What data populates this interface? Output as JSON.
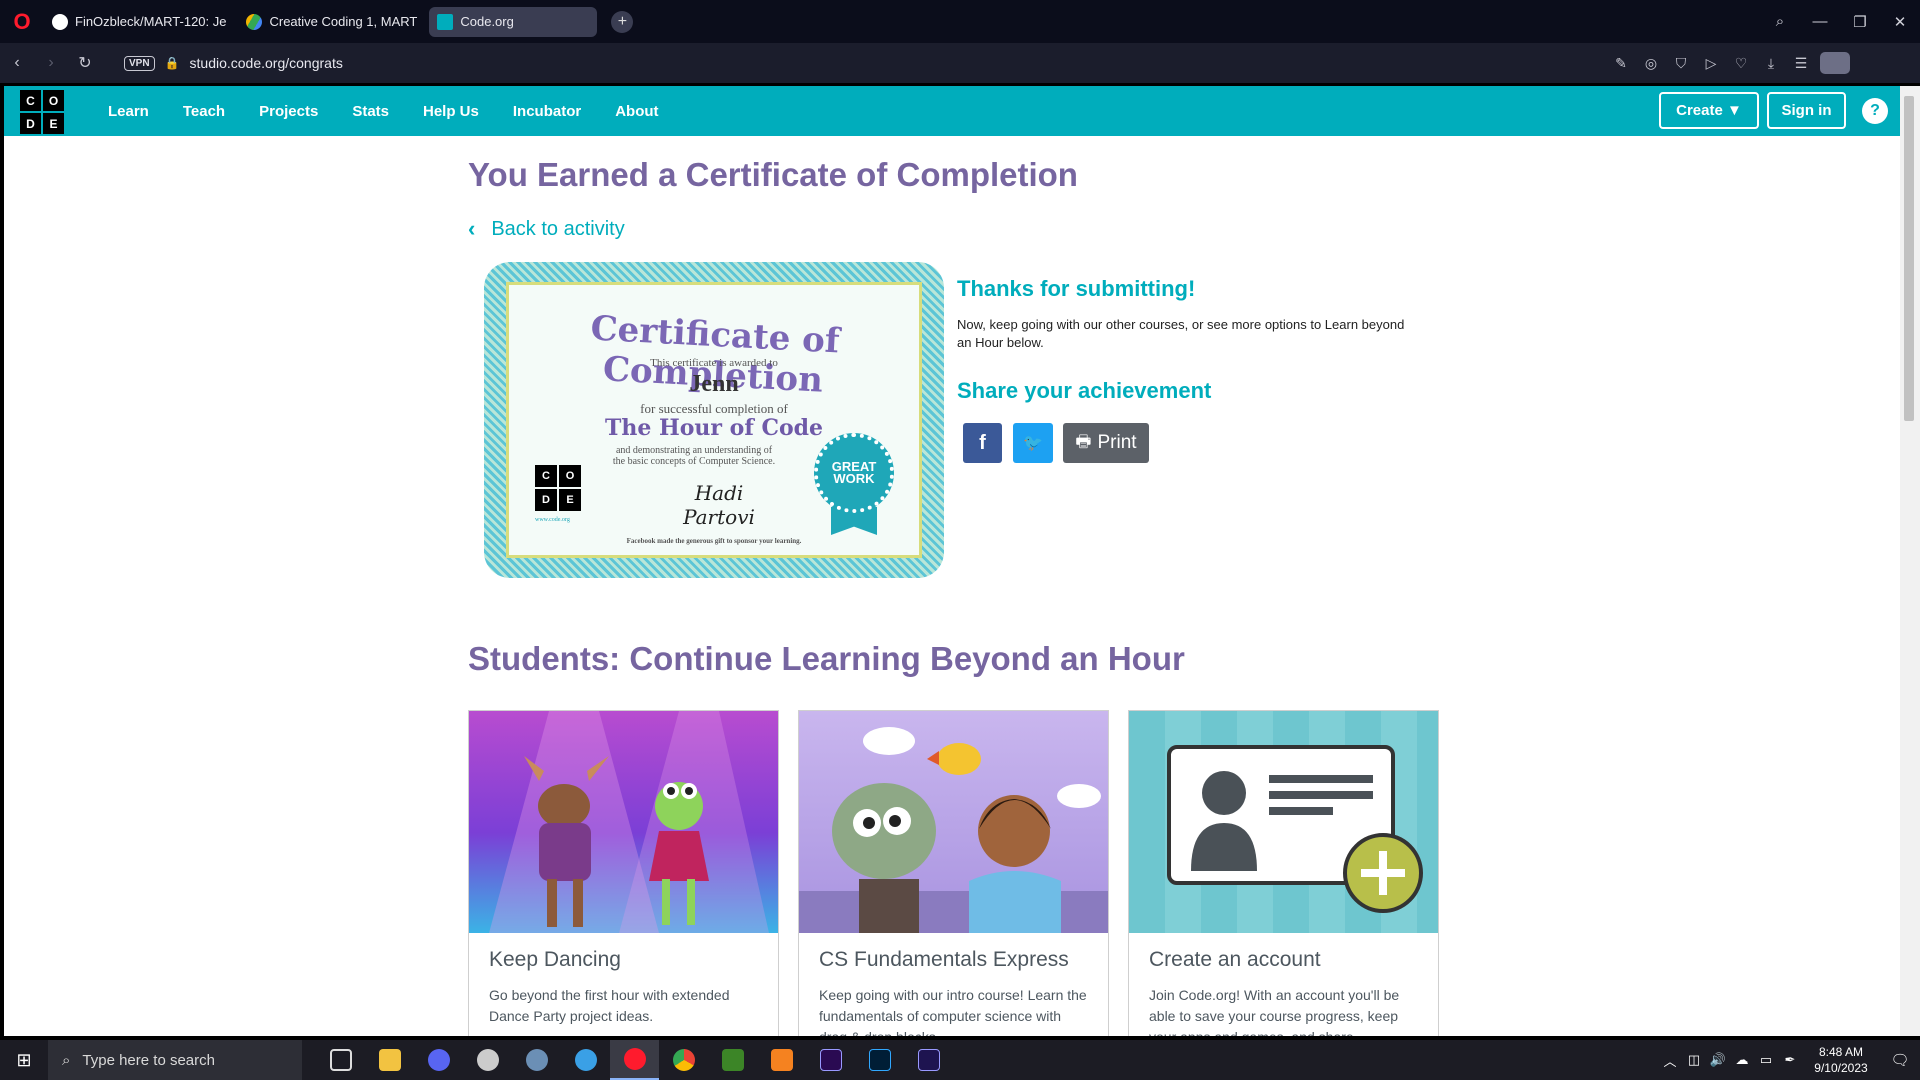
{
  "browser": {
    "tabs": [
      {
        "label": "FinOzbleck/MART-120: Je",
        "icon_color": "#ffffff"
      },
      {
        "label": "Creative Coding 1, MART",
        "icon_color": "#f2b400"
      },
      {
        "label": "Code.org",
        "icon_color": "#00adbc"
      }
    ],
    "new_tab": "+",
    "url": "studio.code.org/congrats",
    "vpn_label": "VPN"
  },
  "site_header": {
    "logo_letters": [
      "C",
      "O",
      "D",
      "E"
    ],
    "nav": [
      "Learn",
      "Teach",
      "Projects",
      "Stats",
      "Help Us",
      "Incubator",
      "About"
    ],
    "create_label": "Create ▼",
    "signin_label": "Sign in",
    "help_label": "?"
  },
  "main": {
    "title": "You Earned a Certificate of Completion",
    "back_label": "Back to activity",
    "certificate": {
      "heading": "Certificate of Completion",
      "awarded_text": "This certificate is awarded to",
      "name": "Jenn",
      "completion_text": "for successful completion of",
      "course": "The Hour of Code",
      "concepts_text": "and demonstrating an understanding of the basic concepts of Computer Science.",
      "signature": "Hadi Partovi",
      "badge_line1": "GREAT",
      "badge_line2": "WORK",
      "site": "www.code.org",
      "footer": "Facebook made the generous gift to sponsor your learning."
    },
    "thanks_heading": "Thanks for submitting!",
    "thanks_body": "Now, keep going with our other courses, or see more options to Learn beyond an Hour below.",
    "share_heading": "Share your achievement",
    "share_buttons": {
      "facebook": "f",
      "twitter": "🐦",
      "print": "Print"
    },
    "section_title": "Students: Continue Learning Beyond an Hour",
    "cards": [
      {
        "title": "Keep Dancing",
        "desc": "Go beyond the first hour with extended Dance Party project ideas."
      },
      {
        "title": "CS Fundamentals Express",
        "desc": "Keep going with our intro course! Learn the fundamentals of computer science with drag & drop blocks."
      },
      {
        "title": "Create an account",
        "desc": "Join Code.org! With an account you'll be able to save your course progress, keep your apps and games, and share."
      }
    ]
  },
  "taskbar": {
    "search_placeholder": "Type here to search",
    "time": "8:48 AM",
    "date": "9/10/2023"
  }
}
